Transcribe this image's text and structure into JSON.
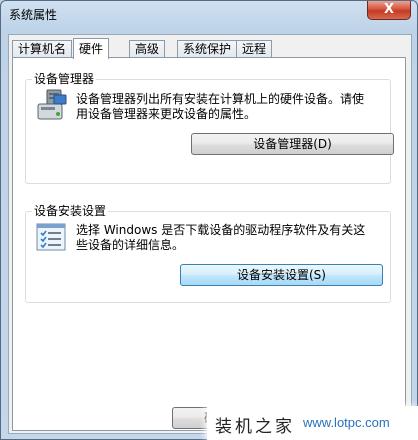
{
  "window": {
    "title": "系统属性",
    "close_label": "X"
  },
  "tabs": [
    {
      "label": "计算机名",
      "active": false
    },
    {
      "label": "硬件",
      "active": true
    },
    {
      "label": "高级",
      "active": false
    },
    {
      "label": "系统保护",
      "active": false
    },
    {
      "label": "远程",
      "active": false
    }
  ],
  "device_manager": {
    "group_title": "设备管理器",
    "description_line1": "设备管理器列出所有安装在计算机上的硬件设备。请使",
    "description_line2": "用设备管理器来更改设备的属性。",
    "button_label": "设备管理器(D)",
    "icon": "device-manager-icon"
  },
  "device_install": {
    "group_title": "设备安装设置",
    "description_line1": "选择 Windows 是否下载设备的驱动程序软件及有关这",
    "description_line2": "些设备的详细信息。",
    "button_label": "设备安装设置(S)",
    "icon": "checklist-icon"
  },
  "footer": {
    "ok_label": "确"
  },
  "watermark": {
    "text": "装机之家",
    "url": "www.lotpc.com"
  }
}
